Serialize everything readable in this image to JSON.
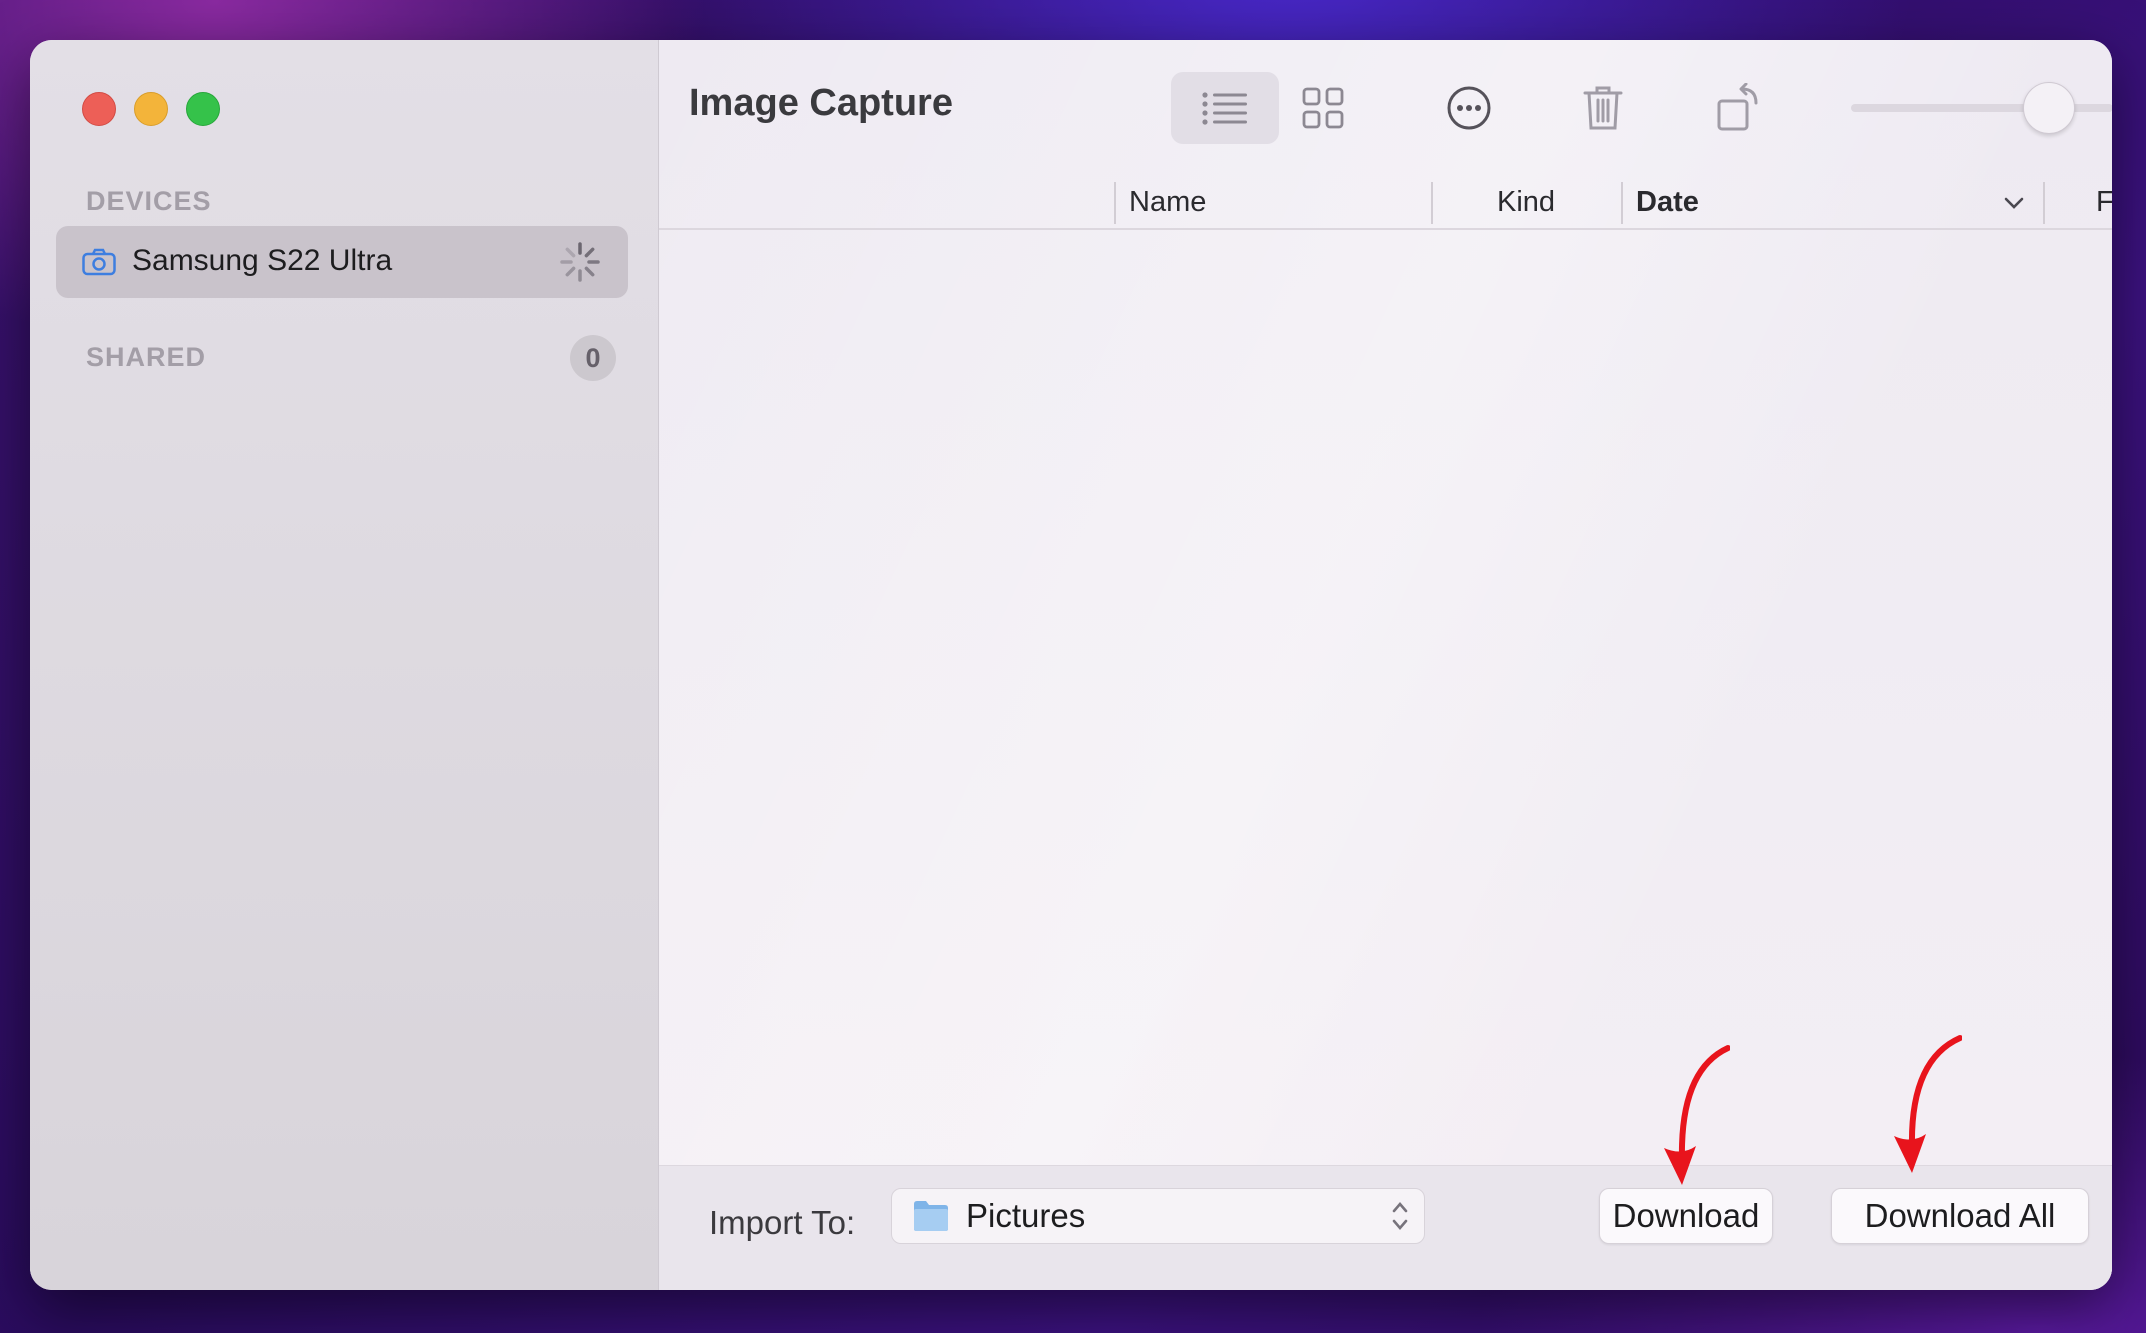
{
  "window": {
    "title": "Image Capture"
  },
  "sidebar": {
    "devices_label": "DEVICES",
    "device": {
      "name": "Samsung S22 Ultra",
      "icon": "camera-icon",
      "status": "loading"
    },
    "shared_label": "SHARED",
    "shared_count": "0"
  },
  "toolbar": {
    "icons": [
      "list-view-icon",
      "grid-view-icon",
      "more-options-icon",
      "trash-icon",
      "rotate-icon"
    ],
    "zoom_slider_value": 0.75
  },
  "columns": [
    "Name",
    "Kind",
    "Date",
    "File"
  ],
  "bottom": {
    "import_to_label": "Import To:",
    "import_destination": "Pictures",
    "download_label": "Download",
    "download_all_label": "Download All"
  },
  "annotations": {
    "arrow_color": "#e8141c"
  }
}
